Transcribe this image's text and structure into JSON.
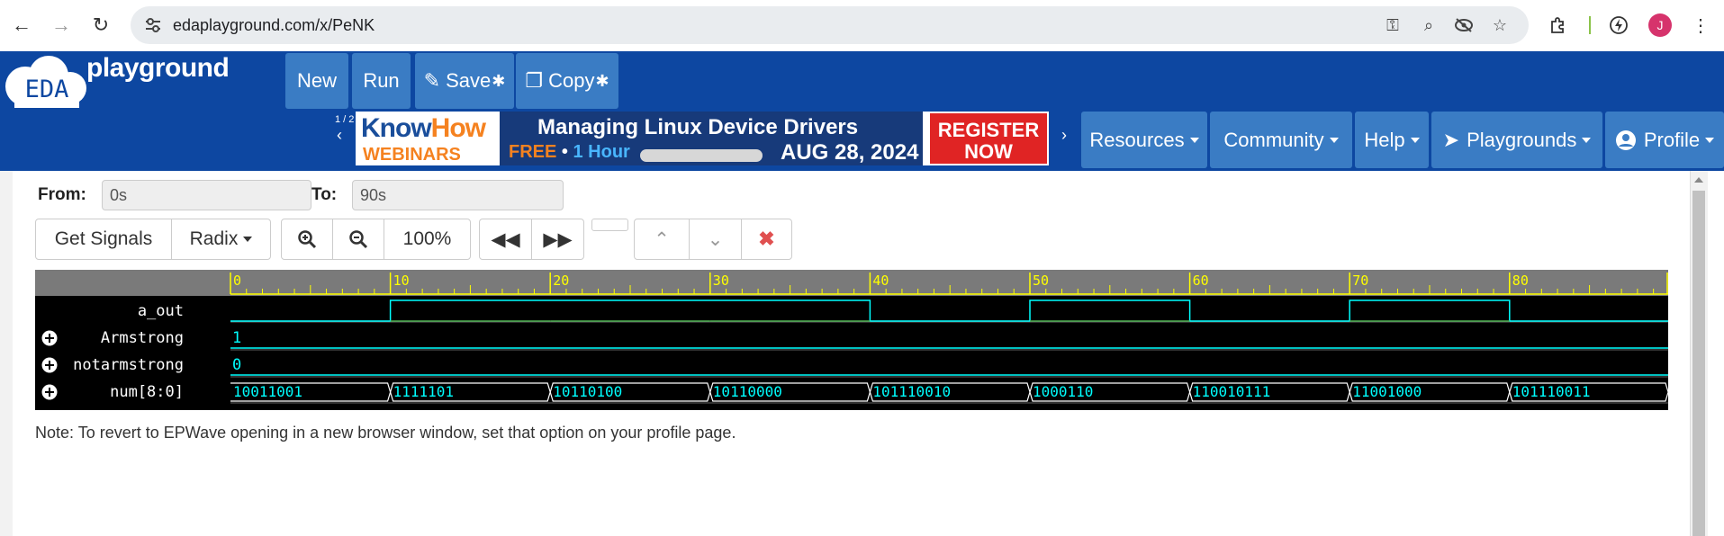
{
  "browser": {
    "url": "edaplayground.com/x/PeNK",
    "avatar_initial": "J",
    "icons": [
      "back-icon",
      "forward-icon",
      "reload-icon",
      "site-info-icon",
      "key-icon",
      "zoom-icon",
      "eye-off-icon",
      "star-icon",
      "extensions-icon",
      "performance-icon",
      "avatar",
      "menu-icon"
    ]
  },
  "header": {
    "logo_eda": "EDA",
    "logo_playground": "playground",
    "buttons": {
      "new": "New",
      "run": "Run",
      "save": "Save",
      "copy": "Copy"
    },
    "carousel": "1 / 2",
    "ad": {
      "brand_know": "Know",
      "brand_how": "How",
      "webinars": "WEBINARS",
      "title": "Managing Linux Device Drivers",
      "free": "FREE",
      "bullet": "•",
      "hour": "1 Hour",
      "date": "AUG 28, 2024",
      "register": "REGISTER",
      "now": "NOW"
    },
    "menu": {
      "resources": "Resources",
      "community": "Community",
      "help": "Help",
      "playgrounds": "Playgrounds",
      "profile": "Profile"
    }
  },
  "controls": {
    "from_label": "From:",
    "from_value": "0s",
    "to_label": "To:",
    "to_value": "90s",
    "get_signals": "Get Signals",
    "radix": "Radix",
    "zoom_level": "100%"
  },
  "waveform": {
    "time_ticks": [
      "0",
      "10",
      "20",
      "30",
      "40",
      "50",
      "60",
      "70",
      "80"
    ],
    "signals": [
      {
        "name": "a_out",
        "expandable": false
      },
      {
        "name": "Armstrong",
        "expandable": true,
        "value": "1"
      },
      {
        "name": "notarmstrong",
        "expandable": true,
        "value": "0"
      },
      {
        "name": "num[8:0]",
        "expandable": true
      }
    ],
    "a_out_levels": [
      0,
      1,
      1,
      1,
      0,
      1,
      0,
      1,
      0
    ],
    "num_values": [
      "10011001",
      "1111101",
      "10110100",
      "10110000",
      "101110010",
      "1000110",
      "110010111",
      "11001000",
      "101110011"
    ],
    "colors": {
      "tick": "#ffff00",
      "wave": "#00ffff",
      "label": "#ffffff"
    }
  },
  "note": "Note: To revert to EPWave opening in a new browser window, set that option on your profile page."
}
